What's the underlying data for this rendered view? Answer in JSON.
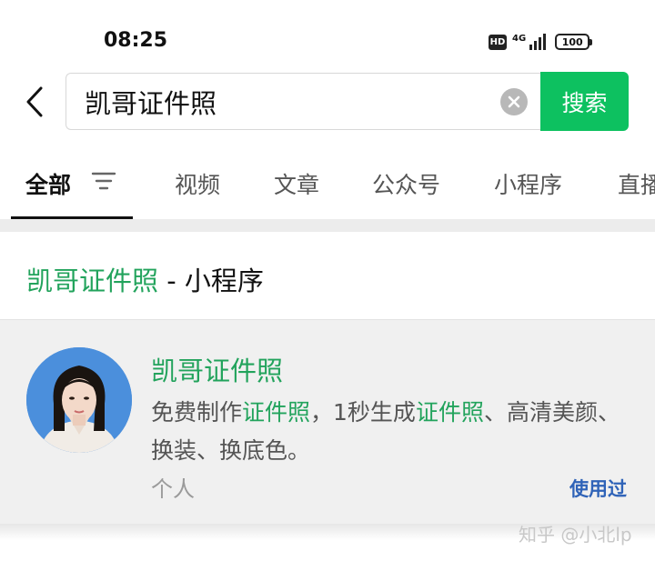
{
  "status_bar": {
    "time": "08:25",
    "hd_label": "HD",
    "network_label": "4G",
    "battery_level": "100"
  },
  "search": {
    "query": "凯哥证件照",
    "button_label": "搜索"
  },
  "tabs": [
    {
      "label": "全部",
      "active": true
    },
    {
      "label": "视频"
    },
    {
      "label": "文章"
    },
    {
      "label": "公众号"
    },
    {
      "label": "小程序"
    },
    {
      "label": "直播"
    }
  ],
  "section": {
    "keyword": "凯哥证件照",
    "suffix": " - 小程序"
  },
  "result": {
    "title": "凯哥证件照",
    "desc_part1": "免费制作",
    "desc_hl1": "证件照",
    "desc_part2": "，1秒生成",
    "desc_hl2": "证件照",
    "desc_part3": "、高清美颜、换装、换底色。",
    "meta": "个人",
    "used_label": "使用过"
  },
  "watermark": "知乎 @小北lp",
  "colors": {
    "accent_green": "#0dc160",
    "highlight_green": "#22a35c",
    "link_blue": "#2f63b8",
    "avatar_bg": "#4b8fdc"
  }
}
